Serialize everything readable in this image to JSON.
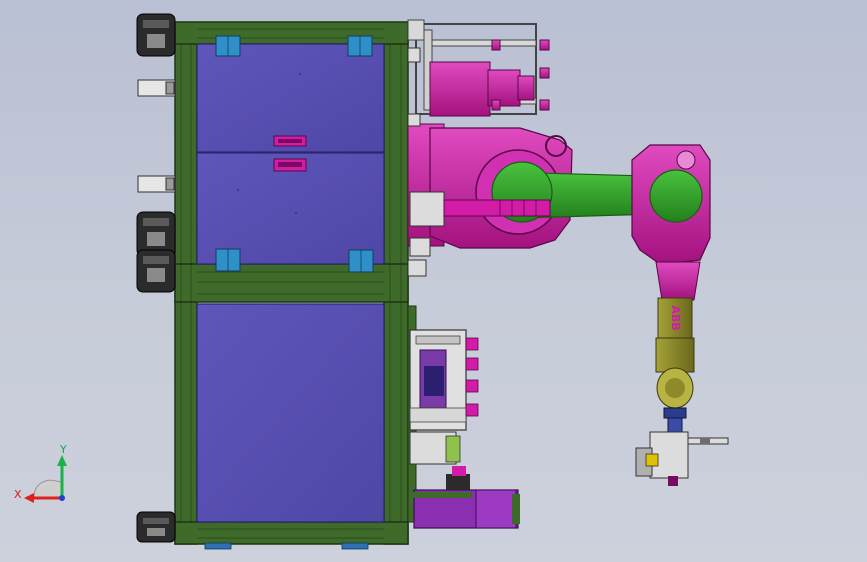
{
  "viewport": {
    "background_top": "#b9c0d3",
    "background_bottom": "#cdd1dc"
  },
  "colors": {
    "frame": "#3f6b2a",
    "frame_dark": "#24401a",
    "panel": "#5b52b3",
    "panel_dark": "#3d3890",
    "robot": "#d21ca8",
    "robot_dark": "#7a0a60",
    "arm_link": "#33a42b",
    "arm_link_dark": "#175e12",
    "wrist": "#8e8a2a",
    "hinge": "#2f8fc9",
    "caster": "#2a2a2a",
    "metal": "#dcdcdc"
  },
  "icons": {
    "triad": "coordinate-triad-icon",
    "hinge": "hinge-icon",
    "caster": "caster-wheel-icon"
  },
  "robot_brand": "ABB",
  "triad": {
    "x_label": "X",
    "y_label": "Y"
  }
}
